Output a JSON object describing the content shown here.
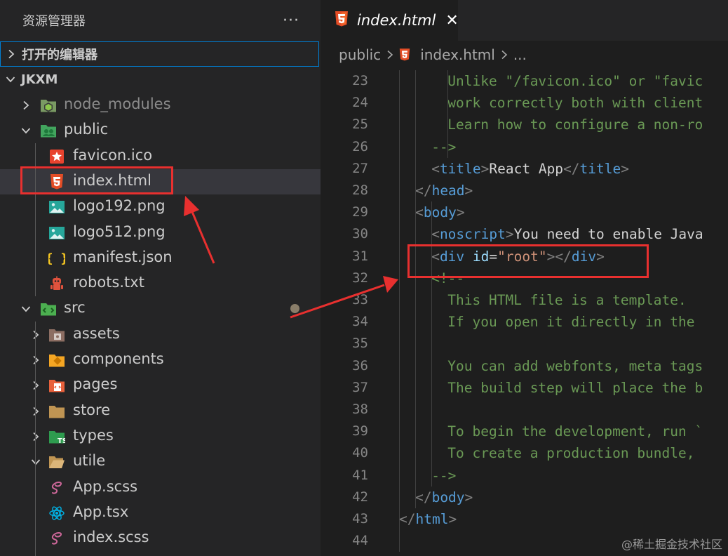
{
  "sidebar": {
    "title": "资源管理器",
    "more_label": "···",
    "open_editors_label": "打开的编辑器",
    "project_label": "JKXM",
    "tree": [
      {
        "label": "node_modules",
        "icon": "nodejs-folder-icon",
        "expandable": true,
        "expanded": false,
        "dim": true
      },
      {
        "label": "public",
        "icon": "public-folder-icon",
        "expandable": true,
        "expanded": true
      },
      {
        "label": "favicon.ico",
        "icon": "favicon-star-icon"
      },
      {
        "label": "index.html",
        "icon": "html5-icon",
        "selected": true
      },
      {
        "label": "logo192.png",
        "icon": "image-icon"
      },
      {
        "label": "logo512.png",
        "icon": "image-icon"
      },
      {
        "label": "manifest.json",
        "icon": "json-braces-icon"
      },
      {
        "label": "robots.txt",
        "icon": "robot-icon"
      },
      {
        "label": "src",
        "icon": "src-folder-icon",
        "expandable": true,
        "expanded": true
      },
      {
        "label": "assets",
        "icon": "assets-folder-icon",
        "expandable": true,
        "expanded": false
      },
      {
        "label": "components",
        "icon": "components-folder-icon",
        "expandable": true,
        "expanded": false
      },
      {
        "label": "pages",
        "icon": "pages-folder-icon",
        "expandable": true,
        "expanded": false
      },
      {
        "label": "store",
        "icon": "folder-icon",
        "expandable": true,
        "expanded": false
      },
      {
        "label": "types",
        "icon": "ts-folder-icon",
        "expandable": true,
        "expanded": false
      },
      {
        "label": "utile",
        "icon": "open-folder-icon",
        "expandable": true,
        "expanded": true
      },
      {
        "label": "App.scss",
        "icon": "sass-icon"
      },
      {
        "label": "App.tsx",
        "icon": "react-icon"
      },
      {
        "label": "index.scss",
        "icon": "sass-icon"
      }
    ]
  },
  "editor": {
    "tab_label": "index.html",
    "tab_close": "✕",
    "breadcrumb": {
      "folder": "public",
      "file": "index.html",
      "more": "..."
    },
    "lines": [
      {
        "num": "23",
        "tokens": [
          {
            "t": "com",
            "v": "Unlike \"/favicon.ico\" or \"favic"
          }
        ]
      },
      {
        "num": "24",
        "tokens": [
          {
            "t": "com",
            "v": "work correctly both with client"
          }
        ]
      },
      {
        "num": "25",
        "tokens": [
          {
            "t": "com",
            "v": "Learn how to configure a non-ro"
          }
        ]
      },
      {
        "num": "26",
        "tokens": [
          {
            "t": "com",
            "v": "-->"
          }
        ]
      },
      {
        "num": "27",
        "tokens": [
          {
            "t": "punct",
            "v": "<"
          },
          {
            "t": "tag",
            "v": "title"
          },
          {
            "t": "punct",
            "v": ">"
          },
          {
            "t": "text",
            "v": "React App"
          },
          {
            "t": "punct",
            "v": "</"
          },
          {
            "t": "tag",
            "v": "title"
          },
          {
            "t": "punct",
            "v": ">"
          }
        ]
      },
      {
        "num": "28",
        "tokens": [
          {
            "t": "punct",
            "v": "</"
          },
          {
            "t": "tag",
            "v": "head"
          },
          {
            "t": "punct",
            "v": ">"
          }
        ]
      },
      {
        "num": "29",
        "tokens": [
          {
            "t": "punct",
            "v": "<"
          },
          {
            "t": "tag",
            "v": "body"
          },
          {
            "t": "punct",
            "v": ">"
          }
        ]
      },
      {
        "num": "30",
        "tokens": [
          {
            "t": "punct",
            "v": "<"
          },
          {
            "t": "tag",
            "v": "noscript"
          },
          {
            "t": "punct",
            "v": ">"
          },
          {
            "t": "text",
            "v": "You need to enable Java"
          }
        ]
      },
      {
        "num": "31",
        "tokens": [
          {
            "t": "punct",
            "v": "<"
          },
          {
            "t": "tag",
            "v": "div"
          },
          {
            "t": "text",
            "v": " "
          },
          {
            "t": "attr",
            "v": "id"
          },
          {
            "t": "text",
            "v": "="
          },
          {
            "t": "str",
            "v": "\"root\""
          },
          {
            "t": "punct",
            "v": "></"
          },
          {
            "t": "tag",
            "v": "div"
          },
          {
            "t": "punct",
            "v": ">"
          }
        ]
      },
      {
        "num": "32",
        "tokens": [
          {
            "t": "com",
            "v": "<!--"
          }
        ]
      },
      {
        "num": "33",
        "tokens": [
          {
            "t": "com",
            "v": "This HTML file is a template."
          }
        ]
      },
      {
        "num": "34",
        "tokens": [
          {
            "t": "com",
            "v": "If you open it directly in the"
          }
        ]
      },
      {
        "num": "35",
        "tokens": []
      },
      {
        "num": "36",
        "tokens": [
          {
            "t": "com",
            "v": "You can add webfonts, meta tags"
          }
        ]
      },
      {
        "num": "37",
        "tokens": [
          {
            "t": "com",
            "v": "The build step will place the b"
          }
        ]
      },
      {
        "num": "38",
        "tokens": []
      },
      {
        "num": "39",
        "tokens": [
          {
            "t": "com",
            "v": "To begin the development, run `"
          }
        ]
      },
      {
        "num": "40",
        "tokens": [
          {
            "t": "com",
            "v": "To create a production bundle,"
          }
        ]
      },
      {
        "num": "41",
        "tokens": [
          {
            "t": "com",
            "v": "-->"
          }
        ]
      },
      {
        "num": "42",
        "tokens": [
          {
            "t": "punct",
            "v": "</"
          },
          {
            "t": "tag",
            "v": "body"
          },
          {
            "t": "punct",
            "v": ">"
          }
        ]
      },
      {
        "num": "43",
        "tokens": [
          {
            "t": "punct",
            "v": "</"
          },
          {
            "t": "tag",
            "v": "html"
          },
          {
            "t": "punct",
            "v": ">"
          }
        ]
      },
      {
        "num": "44",
        "tokens": []
      }
    ]
  },
  "watermark": "@稀土掘金技术社区",
  "colors": {
    "annotation_red": "#e8302f",
    "sidebar_bg": "#252526",
    "editor_bg": "#1e1e1e",
    "selection_bg": "#37373d",
    "focus_border": "#007fd4"
  }
}
